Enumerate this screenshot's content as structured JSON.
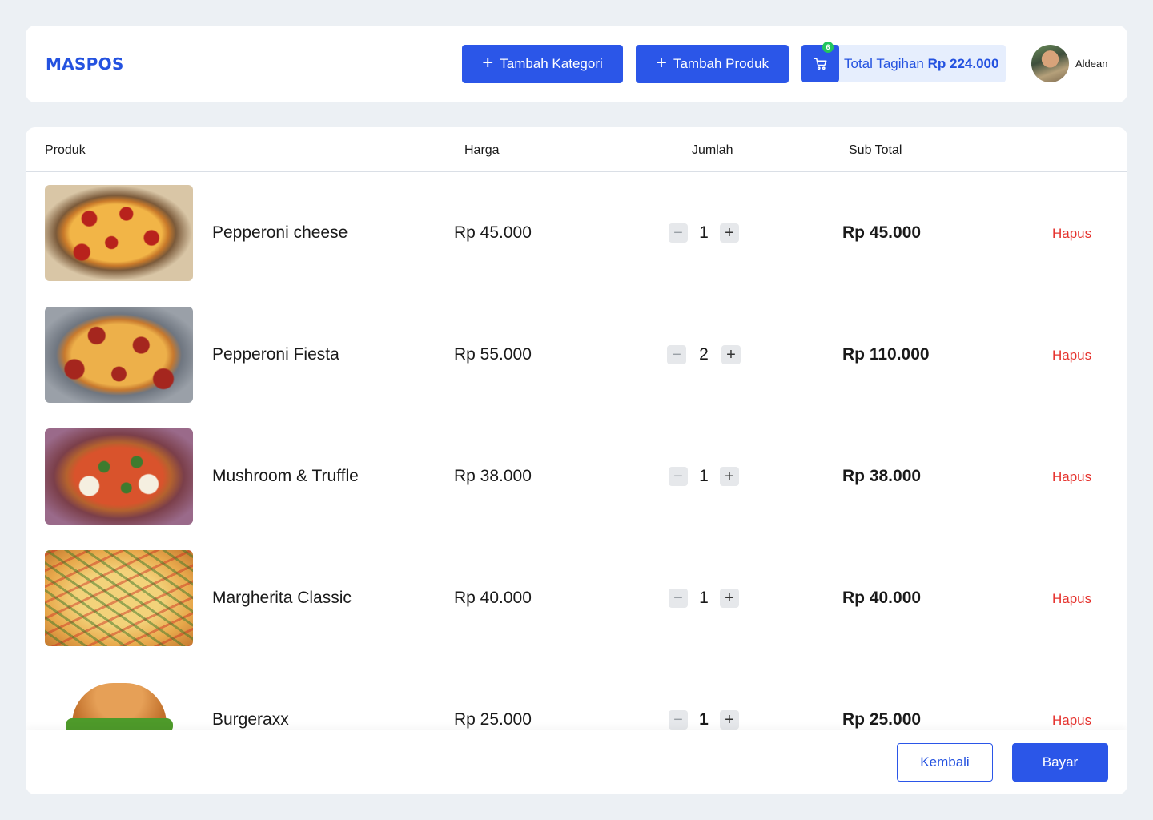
{
  "header": {
    "brand": "MASPOS",
    "add_category_label": "Tambah Kategori",
    "add_product_label": "Tambah Produk",
    "cart_count": "6",
    "total_label": "Total Tagihan",
    "total_amount": "Rp 224.000",
    "user_name": "Aldean"
  },
  "table": {
    "headers": {
      "produk": "Produk",
      "harga": "Harga",
      "jumlah": "Jumlah",
      "subtotal": "Sub Total"
    },
    "rows": [
      {
        "name": "Pepperoni cheese",
        "price": "Rp 45.000",
        "qty": "1",
        "subtotal": "Rp 45.000",
        "remove_label": "Hapus"
      },
      {
        "name": "Pepperoni Fiesta",
        "price": "Rp 55.000",
        "qty": "2",
        "subtotal": "Rp 110.000",
        "remove_label": "Hapus"
      },
      {
        "name": "Mushroom & Truffle",
        "price": "Rp 38.000",
        "qty": "1",
        "subtotal": "Rp 38.000",
        "remove_label": "Hapus"
      },
      {
        "name": "Margherita Classic",
        "price": "Rp 40.000",
        "qty": "1",
        "subtotal": "Rp 40.000",
        "remove_label": "Hapus"
      },
      {
        "name": "Burgeraxx",
        "price": "Rp 25.000",
        "qty": "1",
        "subtotal": "Rp 25.000",
        "remove_label": "Hapus"
      }
    ]
  },
  "footer": {
    "back_label": "Kembali",
    "pay_label": "Bayar"
  },
  "colors": {
    "primary": "#2B56E8",
    "danger": "#E5322D",
    "background": "#ECF0F4",
    "badge": "#22C55E"
  },
  "icons": {
    "add": "plus-icon",
    "cart": "cart-icon",
    "decrement": "minus-icon",
    "increment": "plus-icon"
  }
}
